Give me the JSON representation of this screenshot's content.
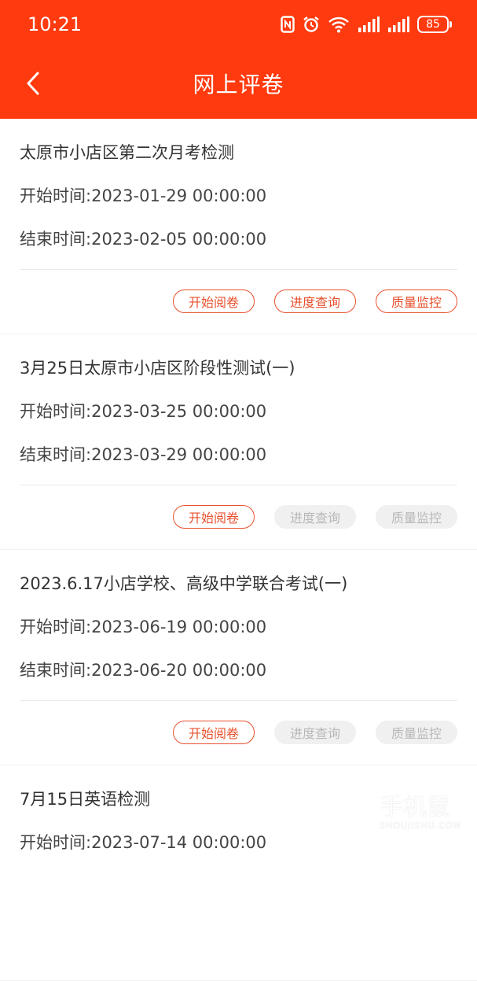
{
  "status_bar": {
    "time": "10:21",
    "battery": "85"
  },
  "header": {
    "title": "网上评卷"
  },
  "labels": {
    "start": "开始时间:",
    "end": "结束时间:"
  },
  "colors": {
    "primary": "#ff3a0e",
    "button_active": "#e8502d",
    "button_disabled": "#b8b8b8"
  },
  "exams": [
    {
      "title": "太原市小店区第二次月考检测",
      "start": "2023-01-29 00:00:00",
      "end": "2023-02-05 00:00:00",
      "buttons": [
        "开始阅卷",
        "进度查询",
        "质量监控"
      ],
      "buttons_enabled": [
        true,
        true,
        true
      ]
    },
    {
      "title": "3月25日太原市小店区阶段性测试(一)",
      "start": "2023-03-25 00:00:00",
      "end": "2023-03-29 00:00:00",
      "buttons": [
        "开始阅卷",
        "进度查询",
        "质量监控"
      ],
      "buttons_enabled": [
        true,
        false,
        false
      ]
    },
    {
      "title": "2023.6.17小店学校、高级中学联合考试(一)",
      "start": "2023-06-19 00:00:00",
      "end": "2023-06-20 00:00:00",
      "buttons": [
        "开始阅卷",
        "进度查询",
        "质量监控"
      ],
      "buttons_enabled": [
        true,
        false,
        false
      ]
    },
    {
      "title": "7月15日英语检测",
      "start": "2023-07-14 00:00:00",
      "end": "",
      "buttons": [],
      "buttons_enabled": []
    }
  ],
  "watermark": {
    "text": "手机鼠",
    "sub": "SHOUJISHU.COM"
  }
}
